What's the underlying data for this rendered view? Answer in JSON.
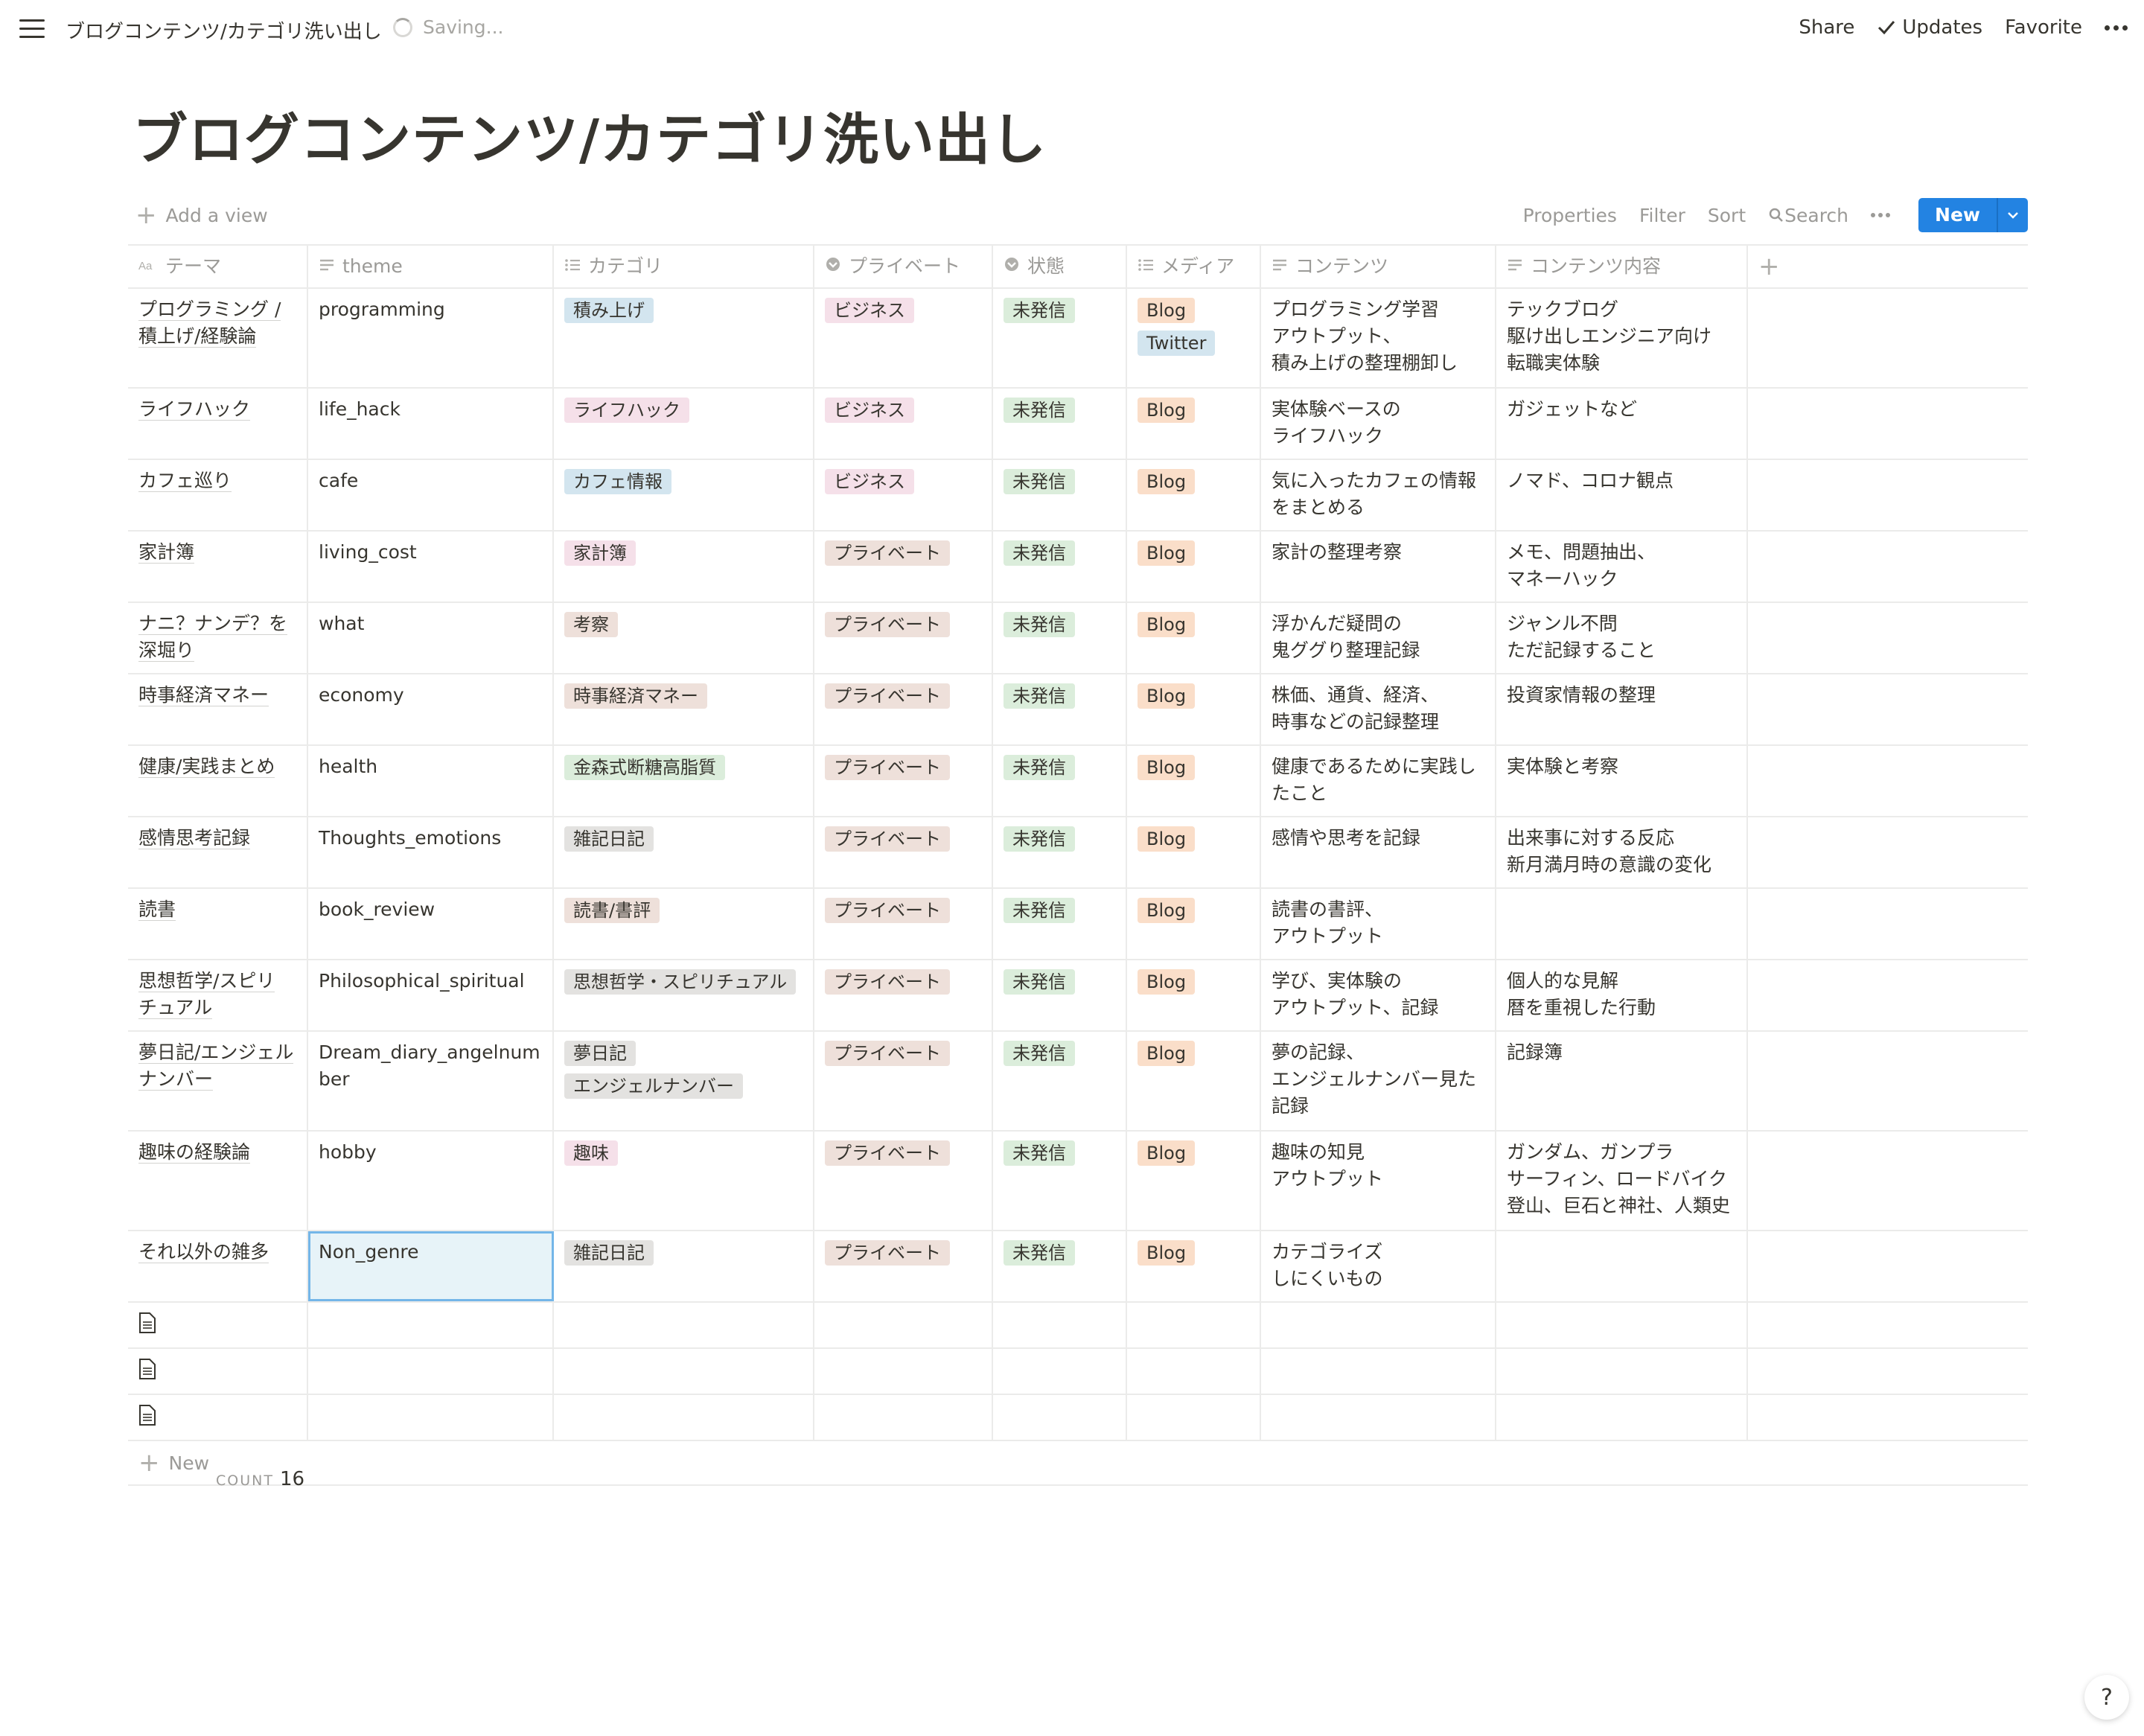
{
  "topbar": {
    "breadcrumb": "ブログコンテンツ/カテゴリ洗い出し",
    "saving": "Saving...",
    "share": "Share",
    "updates": "Updates",
    "favorite": "Favorite"
  },
  "page": {
    "title": "ブログコンテンツ/カテゴリ洗い出し"
  },
  "viewbar": {
    "add_view": "Add a view",
    "properties": "Properties",
    "filter": "Filter",
    "sort": "Sort",
    "search": "Search",
    "new": "New"
  },
  "columns": [
    {
      "label": "テーマ",
      "icon": "title-icon"
    },
    {
      "label": "theme",
      "icon": "text-icon"
    },
    {
      "label": "カテゴリ",
      "icon": "multi-select-icon"
    },
    {
      "label": "プライベート",
      "icon": "select-icon"
    },
    {
      "label": "状態",
      "icon": "select-icon"
    },
    {
      "label": "メディア",
      "icon": "multi-select-icon"
    },
    {
      "label": "コンテンツ",
      "icon": "text-icon"
    },
    {
      "label": "コンテンツ内容",
      "icon": "text-icon"
    }
  ],
  "colors": {
    "tag_blue": "#d3e5ef",
    "tag_pink": "#f5e0e9",
    "tag_green": "#dbeddb",
    "tag_brown": "#eee0da",
    "tag_orange": "#fadec9",
    "tag_gray": "#e3e2e0",
    "tag_purple": "#e8deee",
    "accent": "#2383e2"
  },
  "rows": [
    {
      "t1": "プログラミング /",
      "t2": "積上げ/経験論",
      "theme": "programming",
      "cat": [
        "積み上げ"
      ],
      "cat_colors": [
        "#d3e5ef"
      ],
      "priv": "ビジネス",
      "priv_color": "#f5e0e9",
      "status": "未発信",
      "media": [
        "Blog",
        "Twitter"
      ],
      "media_colors": [
        "#fadec9",
        "#d3e5ef"
      ],
      "content": [
        "プログラミング学習",
        "アウトプット、",
        "積み上げの整理棚卸し"
      ],
      "detail": [
        "テックブログ",
        "駆け出しエンジニア向け",
        "転職実体験"
      ]
    },
    {
      "t1": "ライフハック",
      "t2": "",
      "theme": "life_hack",
      "cat": [
        "ライフハック"
      ],
      "cat_colors": [
        "#f5e0e9"
      ],
      "priv": "ビジネス",
      "priv_color": "#f5e0e9",
      "status": "未発信",
      "media": [
        "Blog"
      ],
      "media_colors": [
        "#fadec9"
      ],
      "content": [
        "実体験ベースの",
        "ライフハック"
      ],
      "detail": [
        "ガジェットなど"
      ]
    },
    {
      "t1": "カフェ巡り",
      "t2": "",
      "theme": "cafe",
      "cat": [
        "カフェ情報"
      ],
      "cat_colors": [
        "#d3e5ef"
      ],
      "priv": "ビジネス",
      "priv_color": "#f5e0e9",
      "status": "未発信",
      "media": [
        "Blog"
      ],
      "media_colors": [
        "#fadec9"
      ],
      "content": [
        "気に入ったカフェの情報",
        "をまとめる"
      ],
      "detail": [
        "ノマド、コロナ観点"
      ]
    },
    {
      "t1": "家計簿",
      "t2": "",
      "theme": "living_cost",
      "cat": [
        "家計簿"
      ],
      "cat_colors": [
        "#f5e0e9"
      ],
      "priv": "プライベート",
      "priv_color": "#eee0da",
      "status": "未発信",
      "media": [
        "Blog"
      ],
      "media_colors": [
        "#fadec9"
      ],
      "content": [
        "家計の整理考察"
      ],
      "detail": [
        "メモ、問題抽出、",
        "マネーハック"
      ]
    },
    {
      "t1": "ナニ？ナンデ？を",
      "t2": "深堀り",
      "theme": "what",
      "cat": [
        "考察"
      ],
      "cat_colors": [
        "#eee0da"
      ],
      "priv": "プライベート",
      "priv_color": "#eee0da",
      "status": "未発信",
      "media": [
        "Blog"
      ],
      "media_colors": [
        "#fadec9"
      ],
      "content": [
        "浮かんだ疑問の",
        "鬼ググり整理記録"
      ],
      "detail": [
        "ジャンル不問",
        "ただ記録すること"
      ]
    },
    {
      "t1": "時事経済マネー",
      "t2": "",
      "theme": "economy",
      "cat": [
        "時事経済マネー"
      ],
      "cat_colors": [
        "#eee0da"
      ],
      "priv": "プライベート",
      "priv_color": "#eee0da",
      "status": "未発信",
      "media": [
        "Blog"
      ],
      "media_colors": [
        "#fadec9"
      ],
      "content": [
        "株価、通貨、経済、",
        "時事などの記録整理"
      ],
      "detail": [
        "投資家情報の整理"
      ]
    },
    {
      "t1": "健康/実践まとめ",
      "t2": "",
      "theme": "health",
      "cat": [
        "金森式断糖高脂質"
      ],
      "cat_colors": [
        "#dbeddb"
      ],
      "priv": "プライベート",
      "priv_color": "#eee0da",
      "status": "未発信",
      "media": [
        "Blog"
      ],
      "media_colors": [
        "#fadec9"
      ],
      "content": [
        "健康であるために実践し",
        "たこと"
      ],
      "detail": [
        "実体験と考察"
      ]
    },
    {
      "t1": "感情思考記録",
      "t2": "",
      "theme": "Thoughts_emotions",
      "cat": [
        "雑記日記"
      ],
      "cat_colors": [
        "#e3e2e0"
      ],
      "priv": "プライベート",
      "priv_color": "#eee0da",
      "status": "未発信",
      "media": [
        "Blog"
      ],
      "media_colors": [
        "#fadec9"
      ],
      "content": [
        "感情や思考を記録"
      ],
      "detail": [
        "出来事に対する反応",
        "新月満月時の意識の変化"
      ]
    },
    {
      "t1": "読書",
      "t2": "",
      "theme": "book_review",
      "cat": [
        "読書/書評"
      ],
      "cat_colors": [
        "#eee0da"
      ],
      "priv": "プライベート",
      "priv_color": "#eee0da",
      "status": "未発信",
      "media": [
        "Blog"
      ],
      "media_colors": [
        "#fadec9"
      ],
      "content": [
        "読書の書評、",
        "アウトプット"
      ],
      "detail": []
    },
    {
      "t1": "思想哲学/スピリ",
      "t2": "チュアル",
      "theme": "Philosophical_spiritual",
      "cat": [
        "思想哲学・スピリチュアル"
      ],
      "cat_colors": [
        "#e3e2e0"
      ],
      "priv": "プライベート",
      "priv_color": "#eee0da",
      "status": "未発信",
      "media": [
        "Blog"
      ],
      "media_colors": [
        "#fadec9"
      ],
      "content": [
        "学び、実体験の",
        "アウトプット、記録"
      ],
      "detail": [
        "個人的な見解",
        "暦を重視した行動"
      ]
    },
    {
      "t1": "夢日記/エンジェル",
      "t2": "ナンバー",
      "theme": "Dream_diary_angelnumber",
      "cat": [
        "夢日記",
        "エンジェルナンバー"
      ],
      "cat_colors": [
        "#e3e2e0",
        "#e3e2e0"
      ],
      "priv": "プライベート",
      "priv_color": "#eee0da",
      "status": "未発信",
      "media": [
        "Blog"
      ],
      "media_colors": [
        "#fadec9"
      ],
      "content": [
        "夢の記録、",
        "エンジェルナンバー見た",
        "記録"
      ],
      "detail": [
        "記録簿"
      ]
    },
    {
      "t1": "趣味の経験論",
      "t2": "",
      "theme": "hobby",
      "cat": [
        "趣味"
      ],
      "cat_colors": [
        "#f5e0e9"
      ],
      "priv": "プライベート",
      "priv_color": "#eee0da",
      "status": "未発信",
      "media": [
        "Blog"
      ],
      "media_colors": [
        "#fadec9"
      ],
      "content": [
        "趣味の知見",
        "アウトプット"
      ],
      "detail": [
        "ガンダム、ガンプラ",
        "サーフィン、ロードバイク",
        "登山、巨石と神社、人類史"
      ]
    },
    {
      "t1": "それ以外の雑多",
      "t2": "",
      "theme": "Non_genre",
      "cat": [
        "雑記日記"
      ],
      "cat_colors": [
        "#e3e2e0"
      ],
      "priv": "プライベート",
      "priv_color": "#eee0da",
      "status": "未発信",
      "media": [
        "Blog"
      ],
      "media_colors": [
        "#fadec9"
      ],
      "content": [
        "カテゴライズ",
        "しにくいもの"
      ],
      "detail": []
    }
  ],
  "row_heights": [],
  "footer": {
    "new": "New",
    "count_label": "COUNT",
    "count_value": "16"
  },
  "help": "?"
}
